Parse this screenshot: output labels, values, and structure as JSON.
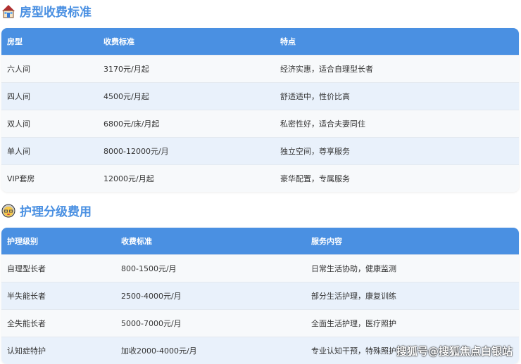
{
  "section1": {
    "title": "房型收费标准",
    "icon": "house-icon",
    "headers": [
      "房型",
      "收费标准",
      "特点"
    ],
    "rows": [
      [
        "六人间",
        "3170元/月起",
        "经济实惠，适合自理型长者"
      ],
      [
        "四人间",
        "4500元/月起",
        "舒适适中，性价比高"
      ],
      [
        "双人间",
        "6800元/床/月起",
        "私密性好，适合夫妻同住"
      ],
      [
        "单人间",
        "8000-12000元/月",
        "独立空间，尊享服务"
      ],
      [
        "VIP套房",
        "12000元/月起",
        "豪华配置，专属服务"
      ]
    ]
  },
  "section2": {
    "title": "护理分级费用",
    "icon": "elderly-face-icon",
    "headers": [
      "护理级别",
      "收费标准",
      "服务内容"
    ],
    "rows": [
      [
        "自理型长者",
        "800-1500元/月",
        "日常生活协助，健康监测"
      ],
      [
        "半失能长者",
        "2500-4000元/月",
        "部分生活护理，康复训练"
      ],
      [
        "全失能长者",
        "5000-7000元/月",
        "全面生活护理，医疗照护"
      ],
      [
        "认知症特护",
        "加收2000-4000元/月",
        "专业认知干预，特殊照护"
      ]
    ]
  },
  "watermark": "搜狐号@搜狐焦点白银站",
  "colors": {
    "accent": "#4a90e2"
  }
}
